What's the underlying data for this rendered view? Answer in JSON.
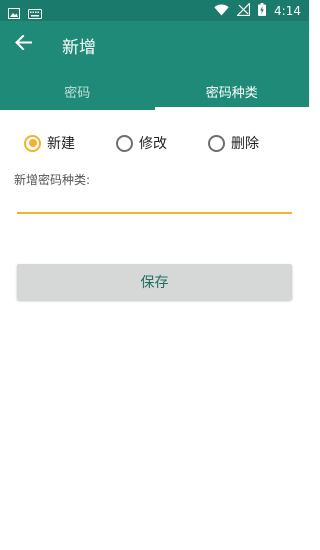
{
  "status_bar": {
    "time": "4:14",
    "icons": [
      "image-icon",
      "keyboard-icon",
      "wifi-icon",
      "signal-off-icon",
      "battery-charging-icon"
    ]
  },
  "toolbar": {
    "title": "新增",
    "back_icon": "arrow-back-icon"
  },
  "tabs": [
    {
      "label": "密码",
      "active": false
    },
    {
      "label": "密码种类",
      "active": true
    }
  ],
  "mode": {
    "options": [
      "新建",
      "修改",
      "删除"
    ],
    "selected": "新建"
  },
  "form": {
    "field_label": "新增密码种类:",
    "field_value": ""
  },
  "actions": {
    "save_label": "保存"
  },
  "colors": {
    "status_bar": "#1a7a6b",
    "primary": "#1f8a78",
    "accent": "#f0b32a",
    "button_bg": "#d6d7d7",
    "button_text": "#1f6f63"
  }
}
